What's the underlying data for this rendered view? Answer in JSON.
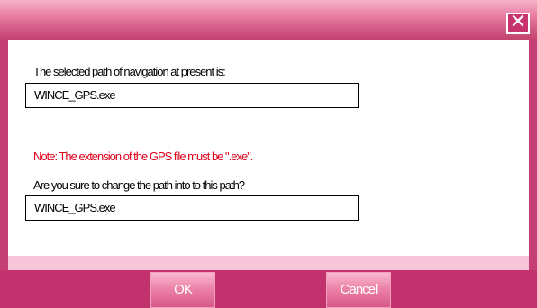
{
  "dialog": {
    "close_symbol": "✕",
    "selected_path_label": "The selected path of navigation at present is:",
    "selected_path_value": "WINCE_GPS.exe",
    "note": "Note: The extension of the GPS file must be \".exe\".",
    "confirm_question": "Are you sure to change the path into to this path?",
    "new_path_value": "WINCE_GPS.exe",
    "ok_label": "OK",
    "cancel_label": "Cancel"
  }
}
